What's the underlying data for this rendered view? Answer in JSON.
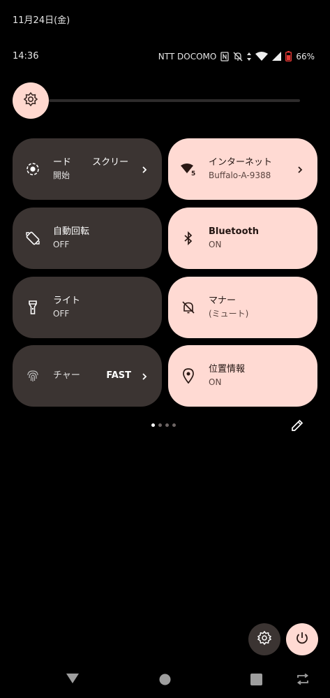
{
  "status": {
    "date": "11月24日(金)",
    "time": "14:36",
    "carrier": "NTT DOCOMO",
    "battery": "66%"
  },
  "tiles": [
    {
      "title": "ード　　 スクリー",
      "subtitle": "開始",
      "icon": "screen-record-icon",
      "state": "off"
    },
    {
      "title": "インターネット",
      "subtitle": "Buffalo-A-9388",
      "icon": "wifi-icon",
      "state": "on"
    },
    {
      "title": "自動回転",
      "subtitle": "OFF",
      "icon": "auto-rotate-icon",
      "state": "off"
    },
    {
      "title": "Bluetooth",
      "subtitle": "ON",
      "icon": "bluetooth-icon",
      "state": "on"
    },
    {
      "title": "ライト",
      "subtitle": "OFF",
      "icon": "flashlight-icon",
      "state": "off"
    },
    {
      "title": "マナー",
      "subtitle": "(ミュート)",
      "icon": "bell-off-icon",
      "state": "on"
    },
    {
      "title": "チャー",
      "subtitle": "FAST",
      "icon": "fingerprint-icon",
      "state": "off"
    },
    {
      "title": "位置情報",
      "subtitle": "ON",
      "icon": "location-pin-icon",
      "state": "on"
    }
  ],
  "pager": {
    "pages": 4,
    "current": 1
  },
  "colors": {
    "tile_on": "#ffdad3",
    "tile_off": "#3b3432",
    "accent": "#ffd8cf"
  }
}
